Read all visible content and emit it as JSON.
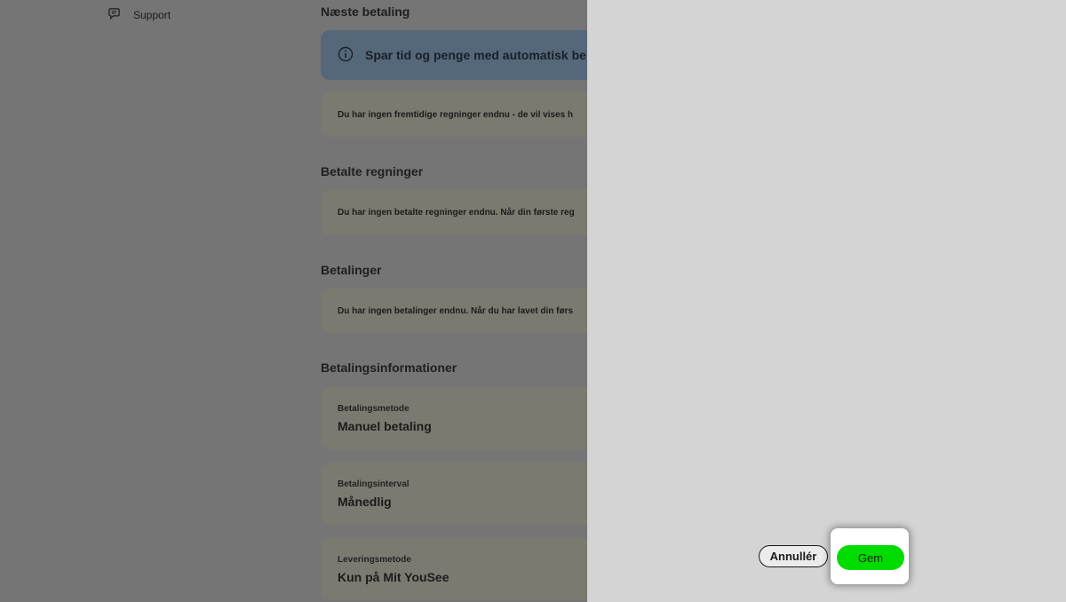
{
  "sidebar": {
    "support_label": "Support"
  },
  "main": {
    "next_payment": {
      "title": "Næste betaling",
      "info_banner": "Spar tid og penge med automatisk be",
      "message": "Du har ingen fremtidige regninger endnu - de vil vises h"
    },
    "paid_bills": {
      "title": "Betalte regninger",
      "message": "Du har ingen betalte regninger endnu. Når din første reg"
    },
    "payments": {
      "title": "Betalinger",
      "message": "Du har ingen betalinger endnu. Når du har lavet din førs"
    },
    "payment_info": {
      "title": "Betalingsinformationer",
      "fields": [
        {
          "label": "Betalingsmetode",
          "value": "Manuel betaling"
        },
        {
          "label": "Betalingsinterval",
          "value": "Månedlig"
        },
        {
          "label": "Leveringsmetode",
          "value": "Kun på Mit YouSee"
        }
      ]
    }
  },
  "drawer": {
    "cancel_label": "Annullér",
    "save_label": "Gem"
  },
  "colors": {
    "save_accent": "#00dc00",
    "overlay_dim": "#757575",
    "drawer_bg": "#d4d4d4"
  }
}
